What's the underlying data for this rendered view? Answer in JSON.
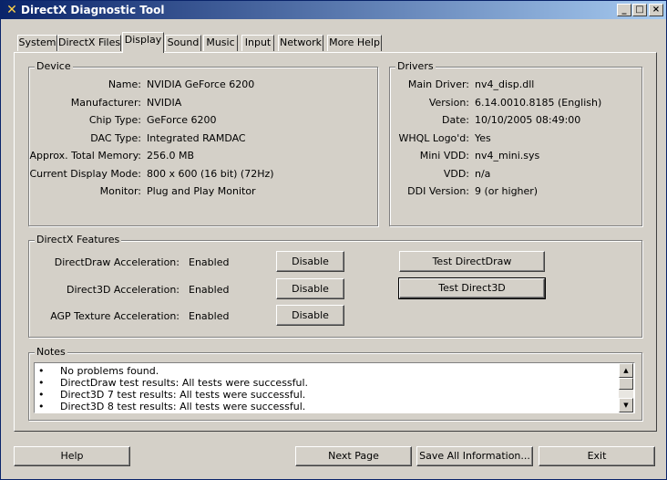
{
  "window": {
    "title": "DirectX Diagnostic Tool"
  },
  "tabs": [
    "System",
    "DirectX Files",
    "Display",
    "Sound",
    "Music",
    "Input",
    "Network",
    "More Help"
  ],
  "device": {
    "title": "Device",
    "rows": [
      {
        "label": "Name:",
        "value": "NVIDIA GeForce 6200"
      },
      {
        "label": "Manufacturer:",
        "value": "NVIDIA"
      },
      {
        "label": "Chip Type:",
        "value": "GeForce 6200"
      },
      {
        "label": "DAC Type:",
        "value": "Integrated RAMDAC"
      },
      {
        "label": "Approx. Total Memory:",
        "value": "256.0 MB"
      },
      {
        "label": "Current Display Mode:",
        "value": "800 x 600 (16 bit) (72Hz)"
      },
      {
        "label": "Monitor:",
        "value": "Plug and Play Monitor"
      }
    ]
  },
  "drivers": {
    "title": "Drivers",
    "rows": [
      {
        "label": "Main Driver:",
        "value": "nv4_disp.dll"
      },
      {
        "label": "Version:",
        "value": "6.14.0010.8185 (English)"
      },
      {
        "label": "Date:",
        "value": "10/10/2005 08:49:00"
      },
      {
        "label": "WHQL Logo'd:",
        "value": "Yes"
      },
      {
        "label": "Mini VDD:",
        "value": "nv4_mini.sys"
      },
      {
        "label": "VDD:",
        "value": "n/a"
      },
      {
        "label": "DDI Version:",
        "value": "9 (or higher)"
      }
    ]
  },
  "features": {
    "title": "DirectX Features",
    "rows": [
      {
        "label": "DirectDraw Acceleration:",
        "value": "Enabled",
        "button": "Disable"
      },
      {
        "label": "Direct3D Acceleration:",
        "value": "Enabled",
        "button": "Disable"
      },
      {
        "label": "AGP Texture Acceleration:",
        "value": "Enabled",
        "button": "Disable"
      }
    ],
    "test_directdraw": "Test DirectDraw",
    "test_direct3d": "Test Direct3D"
  },
  "notes": {
    "title": "Notes",
    "bullet": "•",
    "lines": [
      "No problems found.",
      "DirectDraw test results: All tests were successful.",
      "Direct3D 7 test results: All tests were successful.",
      "Direct3D 8 test results: All tests were successful."
    ]
  },
  "bottom_buttons": {
    "help": "Help",
    "next_page": "Next Page",
    "save_all": "Save All Information...",
    "exit": "Exit"
  },
  "window_controls": {
    "minimize": "_",
    "maximize": "□",
    "close": "×"
  }
}
